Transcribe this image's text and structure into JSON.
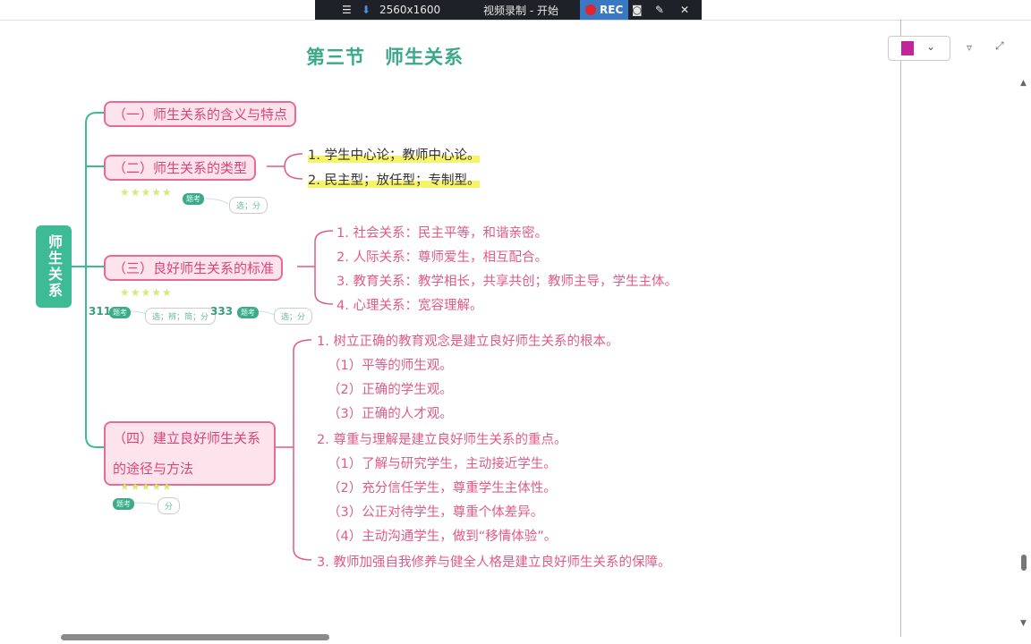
{
  "recorder": {
    "resolution": "2560x1600",
    "status": "视频录制 - 开始",
    "rec": "REC"
  },
  "title": "第三节　师生关系",
  "root": "师生关系",
  "nodes": [
    {
      "label": "（一）师生关系的含义与特点"
    },
    {
      "label": "（二）师生关系的类型",
      "items": [
        "1. 学生中心论；教师中心论。",
        "2. 民主型；放任型；专制型。"
      ]
    },
    {
      "label": "（三）良好师生关系的标准",
      "items": [
        "1. 社会关系：民主平等，和谐亲密。",
        "2. 人际关系：尊师爱生，相互配合。",
        "3. 教育关系：教学相长，共享共创；教师主导，学生主体。",
        "4. 心理关系：宽容理解。"
      ]
    },
    {
      "label": "（四）建立良好师生关系的途径与方法",
      "items": [
        "1. 树立正确的教育观念是建立良好师生关系的根本。",
        "（1）平等的师生观。",
        "（2）正确的学生观。",
        "（3）正确的人才观。",
        "2. 尊重与理解是建立良好师生关系的重点。",
        "（1）了解与研究学生，主动接近学生。",
        "（2）充分信任学生，尊重学生主体性。",
        "（3）公正对待学生，尊重个体差异。",
        "（4）主动沟通学生，做到“移情体验”。",
        "3. 教师加强自我修养与健全人格是建立良好师生关系的保障。"
      ]
    }
  ],
  "annotations": {
    "stars": "★★★★★",
    "badge": "题考",
    "t2": "选；分",
    "t3a_num": "311",
    "t3a": "选；辨；简；分",
    "t3b_num": "333",
    "t3b": "选；分",
    "t4": "分"
  }
}
